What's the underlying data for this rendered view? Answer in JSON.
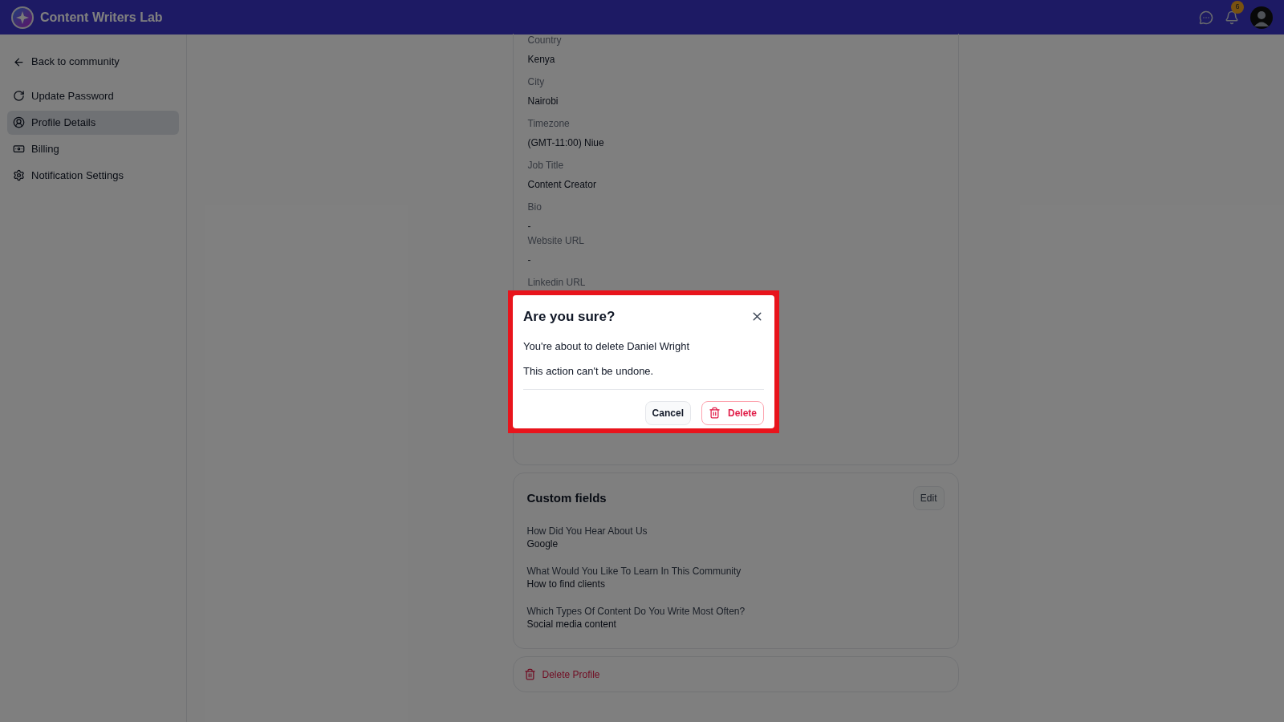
{
  "header": {
    "brand": "Content Writers Lab",
    "notification_count": "6"
  },
  "sidebar": {
    "back_link": "Back to community",
    "items": [
      {
        "label": "Update Password",
        "selected": false
      },
      {
        "label": "Profile Details",
        "selected": true
      },
      {
        "label": "Billing",
        "selected": false
      },
      {
        "label": "Notification Settings",
        "selected": false
      }
    ]
  },
  "profile_fields": [
    {
      "label": "Country",
      "value": "Kenya"
    },
    {
      "label": "City",
      "value": "Nairobi"
    },
    {
      "label": "Timezone",
      "value": "(GMT-11:00) Niue"
    },
    {
      "label": "Job Title",
      "value": "Content Creator"
    },
    {
      "label": "Bio",
      "value": "-"
    },
    {
      "label": "Website URL",
      "value": "-"
    },
    {
      "label": "Linkedin URL"
    }
  ],
  "custom_fields": {
    "title": "Custom fields",
    "edit_button": "Edit",
    "items": [
      {
        "question": "How Did You Hear About Us",
        "answer": "Google"
      },
      {
        "question": "What Would You Like To Learn In This Community",
        "answer": "How to find clients"
      },
      {
        "question": "Which Types Of Content Do You Write Most Often?",
        "answer": "Social media content"
      }
    ]
  },
  "delete_profile": "Delete Profile",
  "dialog": {
    "title": "Are you sure?",
    "message": "You're about to delete Daniel Wright",
    "warning": "This action can't be undone.",
    "cancel": "Cancel",
    "confirm": "Delete"
  }
}
